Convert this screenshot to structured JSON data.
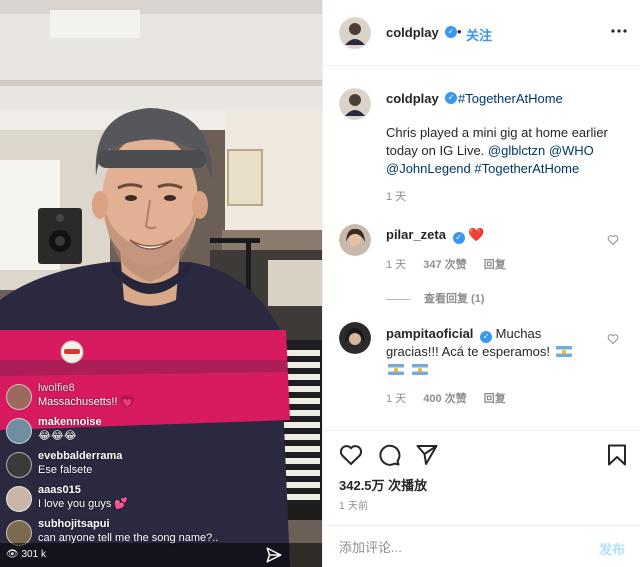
{
  "post": {
    "username": "coldplay",
    "follow_label": "关注",
    "dot": "•",
    "caption_hashtag": "#TogetherAtHome",
    "caption_text": "Chris played a mini gig at home earlier today on IG Live.",
    "caption_mentions": [
      "@glblctzn",
      "@WHO",
      "@JohnLegend"
    ],
    "caption_hashtag_end": "#TogetherAtHome",
    "caption_time": "1 天",
    "likes": "342.5万 次播放",
    "post_time": "1 天前",
    "comment_placeholder": "添加评论...",
    "post_label": "发布"
  },
  "comments": [
    {
      "username": "pilar_zeta",
      "text": "❤️",
      "time": "1 天",
      "likes": "347 次赞",
      "reply": "回复",
      "view_replies": "查看回复 (1)"
    },
    {
      "username": "pampitaoficial",
      "text_1": "Muchas",
      "text_2": "gracias!!! Acá te esperamos!",
      "time": "1 天",
      "likes": "400 次赞",
      "reply": "回复"
    }
  ],
  "live": {
    "viewers": "301 k",
    "comments": [
      {
        "user": "lwolfie8",
        "text": "Massachusetts!! 💗",
        "avatar_color": "#9a6b5c"
      },
      {
        "user": "makennoise",
        "text": "😂😂😂",
        "avatar_color": "#6f8fa0"
      },
      {
        "user": "evebbalderrama",
        "text": "Ese falsete",
        "avatar_color": "#3a3a3a"
      },
      {
        "user": "aaas015",
        "text": "I love you guys 💕",
        "avatar_color": "#c9b6a8"
      },
      {
        "user": "subhojitsapui",
        "text": "can anyone tell me the song name?..",
        "avatar_color": "#7a6a4e"
      }
    ]
  },
  "icons": {
    "verified": "verified-badge-icon",
    "more": "more-options-icon",
    "heart": "heart-icon",
    "comment": "comment-icon",
    "share": "share-icon",
    "bookmark": "bookmark-icon",
    "send": "send-icon",
    "eye": "eye-icon"
  },
  "colors": {
    "link": "#00376b",
    "accent": "#3897f0",
    "muted": "#8e8e8e",
    "sweater_pink": "#d81b60",
    "sweater_navy": "#2b2940",
    "beanie": "#55575a"
  }
}
